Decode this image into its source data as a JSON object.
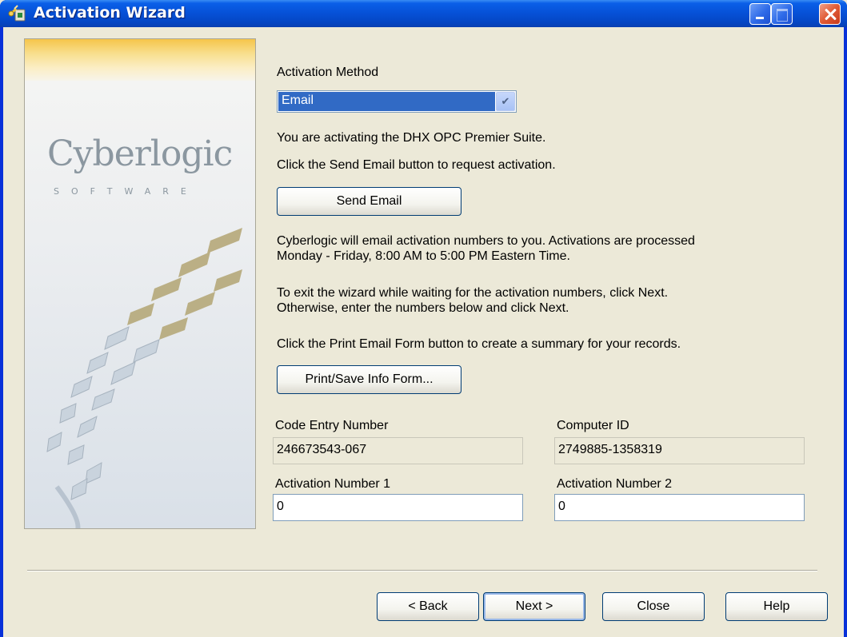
{
  "window": {
    "title": "Activation Wizard"
  },
  "brand": {
    "logo_text": "Cyberlogic",
    "logo_sub": "SOFTWARE"
  },
  "activation": {
    "method_label": "Activation Method",
    "method_value": "Email",
    "info_line_1": "You are activating the DHX OPC Premier Suite.",
    "info_line_2": "Click the Send Email button to request activation.",
    "send_email_button": "Send Email",
    "para1_line1": "Cyberlogic will email activation numbers to you. Activations are processed",
    "para1_line2": "Monday - Friday, 8:00 AM to 5:00 PM Eastern Time.",
    "para2_line1": "To exit the wizard while waiting for the activation numbers, click Next.",
    "para2_line2": "Otherwise, enter the numbers below and click Next.",
    "para3": "Click the Print Email Form button to create a summary for your records.",
    "print_button": "Print/Save Info Form..."
  },
  "fields": {
    "code_entry_label": "Code Entry Number",
    "code_entry_value": "246673543-067",
    "computer_id_label": "Computer ID",
    "computer_id_value": "2749885-1358319",
    "activation1_label": "Activation Number 1",
    "activation1_value": "0",
    "activation2_label": "Activation Number 2",
    "activation2_value": "0"
  },
  "footer": {
    "back": "< Back",
    "next": "Next >",
    "close": "Close",
    "help": "Help"
  },
  "colors": {
    "titlebar": "#0650d6",
    "selection": "#316ac5",
    "dialog_bg": "#ece9d8"
  }
}
